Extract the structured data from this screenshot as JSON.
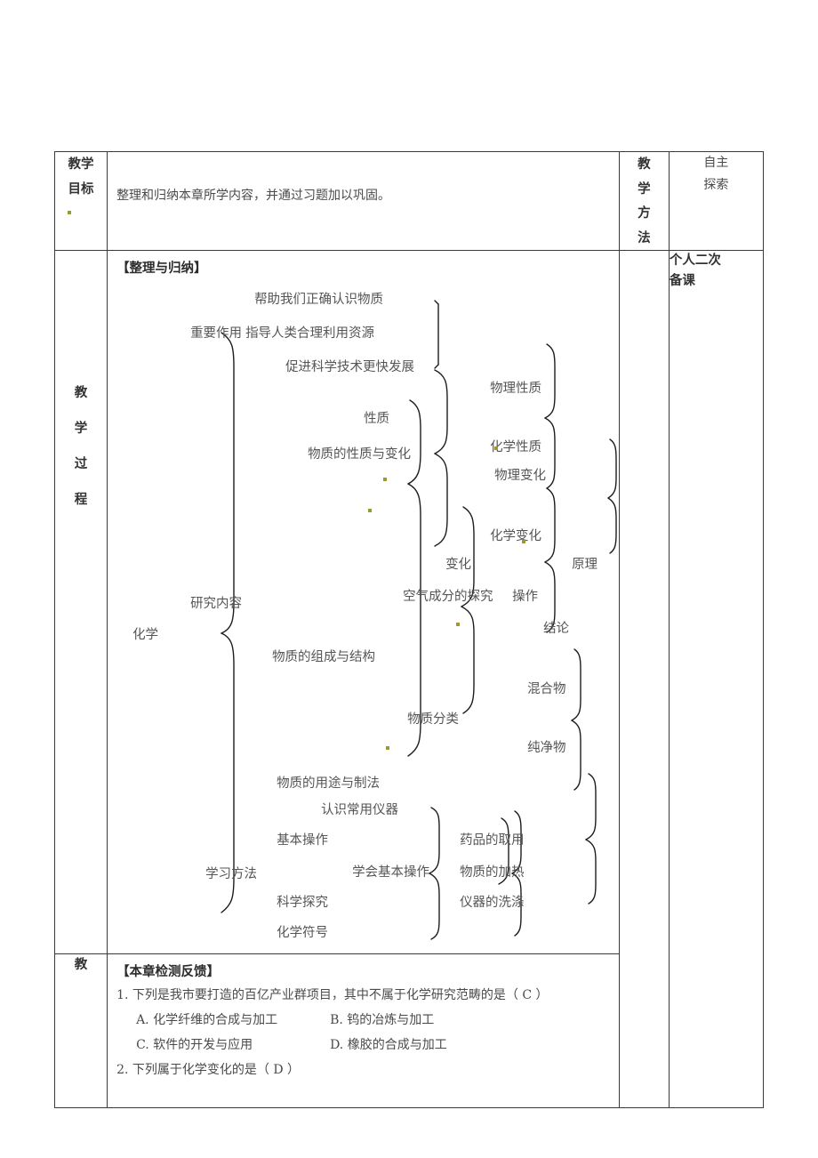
{
  "table": {
    "row_goal": {
      "label_lines": [
        "教",
        "学",
        "目",
        "标"
      ],
      "label_compact": [
        "教学",
        "目标"
      ],
      "content": "整理和归纳本章所学内容，并通过习题加以巩固。",
      "method_lines": [
        "教",
        "学",
        "方",
        "法"
      ],
      "right_lines": [
        "自主",
        "探索"
      ]
    },
    "row_process": {
      "label_lines": [
        "教",
        "学",
        "过",
        "程"
      ],
      "right_lines": [
        "个人二次",
        "备课"
      ]
    },
    "row_bottom": {
      "label": "教"
    }
  },
  "sections": {
    "summary_heading": "【整理与归纳】",
    "quiz_heading": "【本章检测反馈】"
  },
  "tree": {
    "root": "化学",
    "branches": [
      "重要作用",
      "研究内容",
      "学习方法"
    ],
    "important_role": [
      "帮助我们正确认识物质",
      "指导人类合理利用资源",
      "促进科学技术更快发展"
    ],
    "research_content": [
      "物质的性质与变化",
      "物质的组成与结构",
      "物质的用途与制法"
    ],
    "properties_changes": {
      "property": "性质",
      "change": "变化",
      "property_children": [
        "物理性质",
        "化学性质"
      ],
      "change_children": [
        "物理变化",
        "化学变化"
      ]
    },
    "composition": {
      "air_experiment": "空气成分的探究",
      "air_children_group": "操作",
      "air_sub": [
        "原理",
        "结论"
      ],
      "classification": "物质分类",
      "classification_children": [
        "混合物",
        "纯净物"
      ]
    },
    "learning_methods": {
      "items": [
        "基本操作",
        "科学探究",
        "化学符号"
      ],
      "basic_operation_children": [
        "认识常用仪器",
        "学会基本操作"
      ],
      "learn_basic_children": [
        "药品的取用",
        "物质的加热",
        "仪器的洗涤"
      ]
    }
  },
  "quiz": {
    "q1": "1. 下列是我市要打造的百亿产业群项目，其中不属于化学研究范畴的是（  C  ）",
    "q1_opt_a": "A. 化学纤维的合成与加工",
    "q1_opt_b": "B. 钨的冶炼与加工",
    "q1_opt_c": "C. 软件的开发与应用",
    "q1_opt_d": "D. 橡胶的合成与加工",
    "q2": "2. 下列属于化学变化的是（  D  ）"
  },
  "colors": {
    "border": "#3a3a3a",
    "text": "#4a4a4a",
    "heading": "#2c2c2c",
    "artefact": "#9a9a33"
  }
}
